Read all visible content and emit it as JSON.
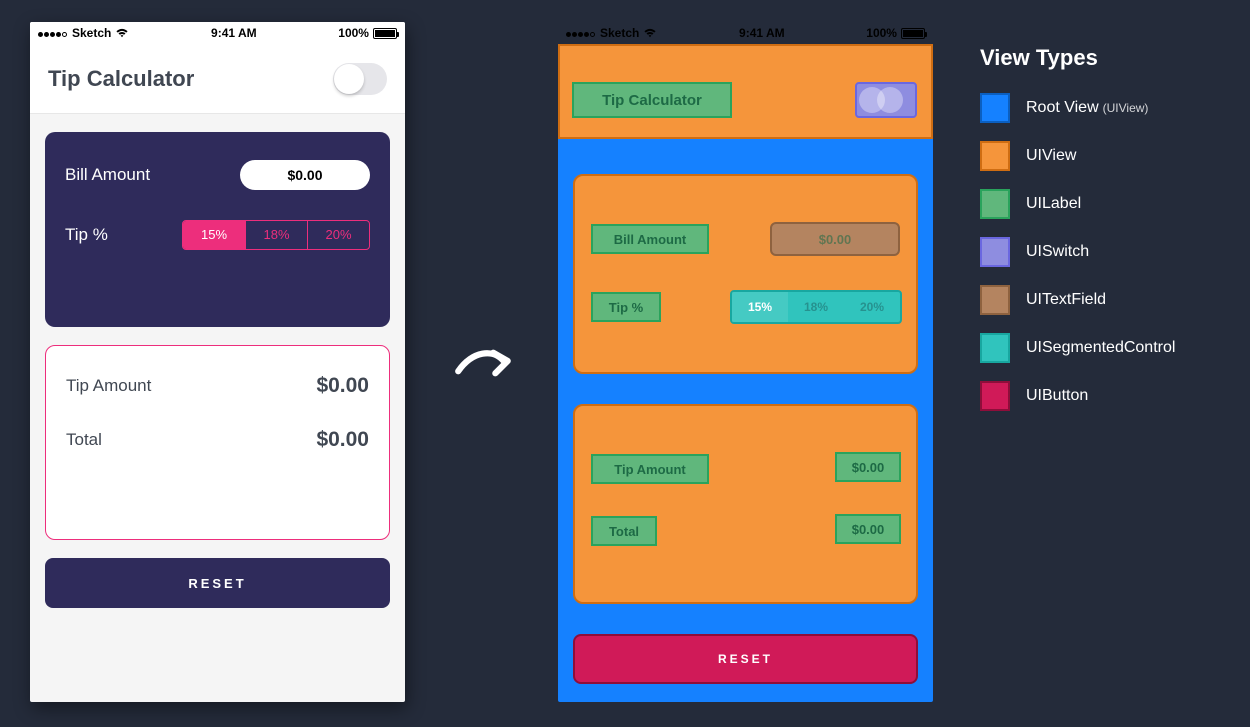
{
  "statusbar": {
    "carrier": "Sketch",
    "time": "9:41 AM",
    "battery": "100%"
  },
  "header": {
    "title": "Tip Calculator"
  },
  "inputs": {
    "bill_label": "Bill Amount",
    "bill_value": "$0.00",
    "tip_label": "Tip %",
    "segments": [
      "15%",
      "18%",
      "20%"
    ],
    "selected_segment": 0
  },
  "outputs": {
    "tip_label": "Tip Amount",
    "tip_value": "$0.00",
    "total_label": "Total",
    "total_value": "$0.00"
  },
  "reset_label": "RESET",
  "legend": {
    "title": "View Types",
    "items": [
      {
        "swatch": "blue",
        "label": "Root View",
        "sub": "(UIView)"
      },
      {
        "swatch": "orange",
        "label": "UIView"
      },
      {
        "swatch": "green",
        "label": "UILabel"
      },
      {
        "swatch": "purple",
        "label": "UISwitch"
      },
      {
        "swatch": "brown",
        "label": "UITextField"
      },
      {
        "swatch": "teal",
        "label": "UISegmentedControl"
      },
      {
        "swatch": "crimson",
        "label": "UIButton"
      }
    ]
  }
}
